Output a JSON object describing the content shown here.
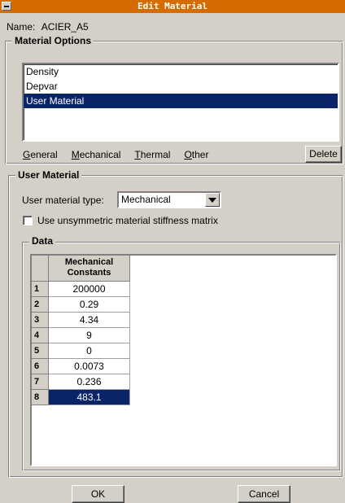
{
  "window": {
    "title": "Edit Material"
  },
  "name": {
    "label": "Name:",
    "value": "ACIER_A5"
  },
  "material_options": {
    "legend": "Material Options",
    "items": [
      "Density",
      "Depvar",
      "User Material"
    ],
    "selected_index": 2,
    "menu": [
      {
        "underlined": "G",
        "rest": "eneral"
      },
      {
        "underlined": "M",
        "rest": "echanical"
      },
      {
        "underlined": "T",
        "rest": "hermal"
      },
      {
        "underlined": "O",
        "rest": "ther"
      }
    ],
    "delete_label": "Delete"
  },
  "user_material": {
    "legend": "User Material",
    "type_label": "User material type:",
    "type_value": "Mechanical",
    "unsymmetric_label": "Use unsymmetric material stiffness matrix",
    "unsymmetric_checked": false
  },
  "data_table": {
    "legend": "Data",
    "column_header_line1": "Mechanical",
    "column_header_line2": "Constants",
    "rows": [
      {
        "index": "1",
        "value": "200000"
      },
      {
        "index": "2",
        "value": "0.29"
      },
      {
        "index": "3",
        "value": "4.34"
      },
      {
        "index": "4",
        "value": "9"
      },
      {
        "index": "5",
        "value": "0"
      },
      {
        "index": "6",
        "value": "0.0073"
      },
      {
        "index": "7",
        "value": "0.236"
      },
      {
        "index": "8",
        "value": "483.1"
      }
    ],
    "selected_row": 8
  },
  "buttons": {
    "ok": "OK",
    "cancel": "Cancel"
  },
  "colors": {
    "title_bar": "#d66b00",
    "selection": "#0a246a",
    "background": "#d4d0c8"
  }
}
